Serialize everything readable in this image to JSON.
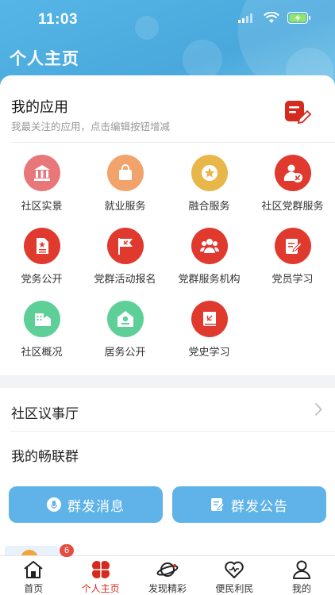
{
  "status_bar": {
    "time": "11:03"
  },
  "header": {
    "title": "个人主页"
  },
  "my_apps": {
    "title": "我的应用",
    "subtitle": "我最关注的应用，点击编辑按钮增减",
    "items": [
      {
        "label": "社区实景",
        "icon": "building-icon",
        "color": "#e8777a"
      },
      {
        "label": "就业服务",
        "icon": "bag-icon",
        "color": "#f2a36b"
      },
      {
        "label": "融合服务",
        "icon": "star-icon",
        "color": "#e9b649"
      },
      {
        "label": "社区党群服务",
        "icon": "party-person-icon",
        "color": "#e03a2f"
      },
      {
        "label": "党务公开",
        "icon": "party-doc-icon",
        "color": "#e03a2f"
      },
      {
        "label": "党群活动报名",
        "icon": "party-flag-icon",
        "color": "#e03a2f"
      },
      {
        "label": "党群服务机构",
        "icon": "group-icon",
        "color": "#e03a2f"
      },
      {
        "label": "党员学习",
        "icon": "study-icon",
        "color": "#e03a2f"
      },
      {
        "label": "社区概况",
        "icon": "community-icon",
        "color": "#5fcf98"
      },
      {
        "label": "居务公开",
        "icon": "house-icon",
        "color": "#5fcf98"
      },
      {
        "label": "党史学习",
        "icon": "party-book-icon",
        "color": "#e03a2f"
      }
    ]
  },
  "rows": {
    "council": "社区议事厅",
    "groups": "我的畅联群"
  },
  "actions": {
    "broadcast_message": "群发消息",
    "broadcast_notice": "群发公告"
  },
  "badge_count": "6",
  "tabbar": {
    "items": [
      {
        "label": "首页",
        "icon": "home-icon"
      },
      {
        "label": "个人主页",
        "icon": "personal-icon"
      },
      {
        "label": "发现精彩",
        "icon": "planet-icon"
      },
      {
        "label": "便民利民",
        "icon": "heart-icon"
      },
      {
        "label": "我的",
        "icon": "user-icon"
      }
    ],
    "active_color": "#d52b1e"
  }
}
